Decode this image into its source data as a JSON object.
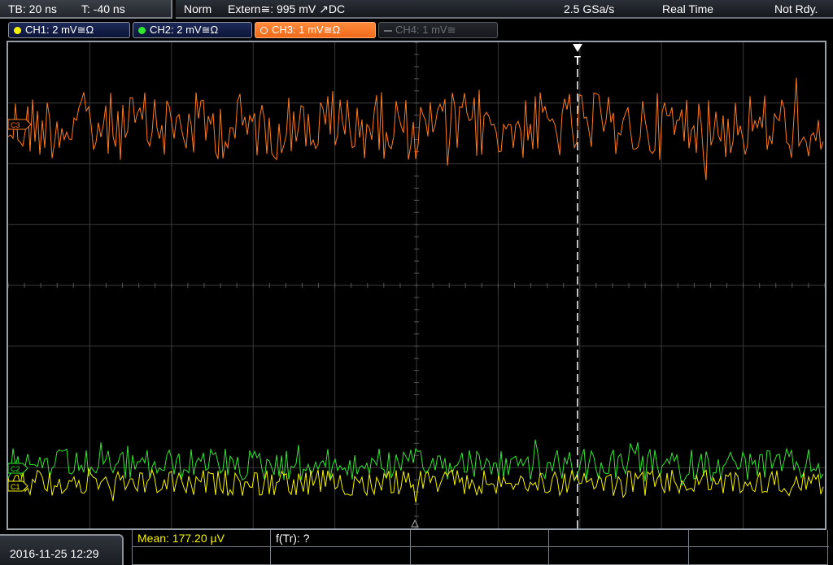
{
  "status": {
    "timebase": "TB: 20 ns",
    "trigger_time": "T: -40 ns",
    "trigger_mode": "Norm",
    "trigger_source": "Extern≅: 995 mV ↗DC",
    "sample_rate": "2.5 GSa/s",
    "acq_mode": "Real Time",
    "state": "Not Rdy."
  },
  "channels": [
    {
      "label": "CH1: 2 mV≅Ω",
      "color": "#f5f200",
      "active": false
    },
    {
      "label": "CH2: 2 mV≅Ω",
      "color": "#33e533",
      "active": false
    },
    {
      "label": "CH3: 1 mV≅Ω",
      "color": "#ff7a1f",
      "active": true
    },
    {
      "label": "CH4: 1 mV≅",
      "color": "#6b6f76",
      "active": false
    }
  ],
  "markers": {
    "trigger": "T",
    "ch3_ref": "C3",
    "ch2_ref": "C2",
    "ch1_ref": "C1"
  },
  "datetime": "2016-11-25 12:29",
  "measurements": {
    "mean": "Mean: 177.20 µV",
    "ftr": "f(Tr): ?"
  },
  "colors": {
    "ch1": "#f5f200",
    "ch2": "#33e533",
    "ch3": "#ff7a1f",
    "grid": "#3a3a3a"
  }
}
